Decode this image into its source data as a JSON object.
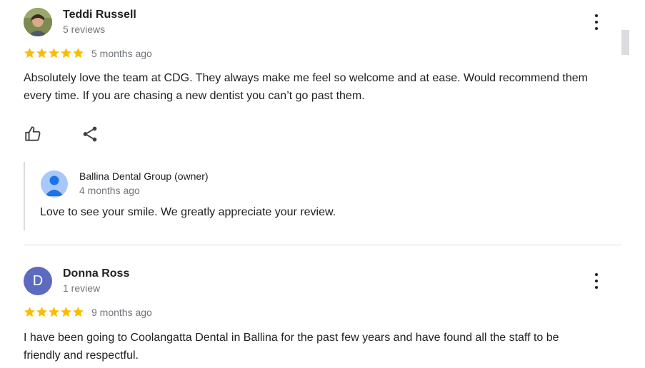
{
  "colors": {
    "star": "#fbbc04",
    "accent_avatar": "#5c6bc0",
    "owner_avatar": "#a8c7fa"
  },
  "reviews": [
    {
      "name": "Teddi Russell",
      "meta": "5 reviews",
      "rating": 5,
      "time": "5 months ago",
      "text": "Absolutely love the team at CDG. They always make me feel so welcome and at ease. Would recommend them every time. If you are chasing a new dentist you can’t go past them.",
      "owner_reply": {
        "name": "Ballina Dental Group (owner)",
        "time": "4 months ago",
        "text": "Love to see your smile. We greatly appreciate your review."
      }
    },
    {
      "name": "Donna Ross",
      "initial": "D",
      "meta": "1 review",
      "rating": 5,
      "time": "9 months ago",
      "text": "I have been going to Coolangatta Dental in Ballina for the past few years and have found all the staff to be friendly and respectful."
    }
  ],
  "icons": {
    "menu": "more-vert-icon",
    "like": "thumb-up-icon",
    "share": "share-icon",
    "star": "star-icon"
  }
}
